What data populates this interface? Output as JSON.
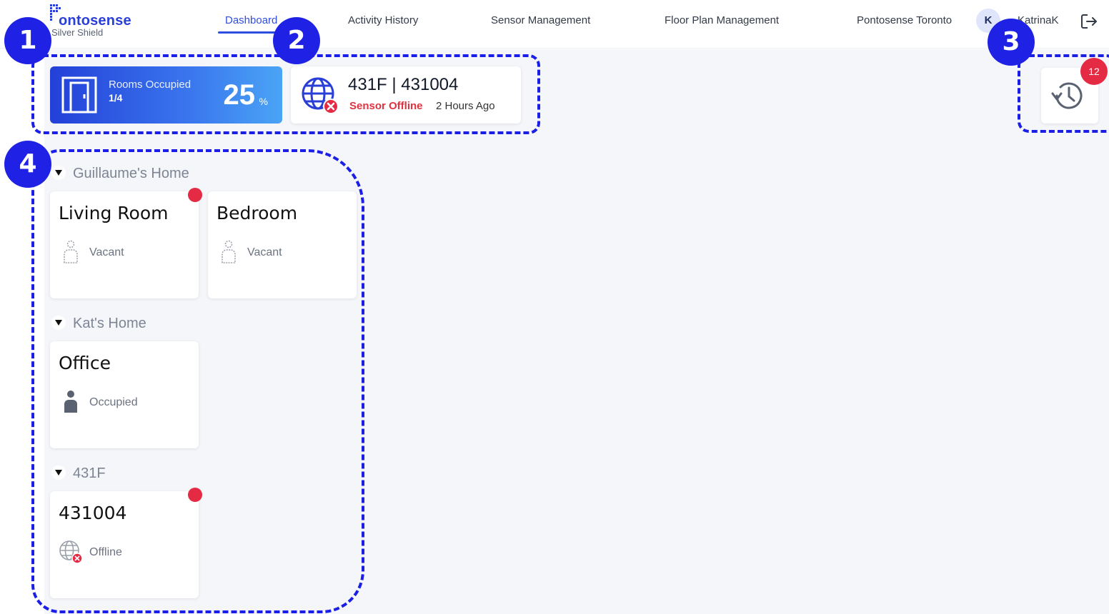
{
  "brand": {
    "name": "ontosense",
    "subtitle": "Silver Shield"
  },
  "nav": {
    "items": [
      {
        "label": "Dashboard",
        "active": true
      },
      {
        "label": "Activity History"
      },
      {
        "label": "Sensor Management"
      },
      {
        "label": "Floor Plan Management"
      },
      {
        "label": "Pontosense Toronto"
      }
    ],
    "user": {
      "initial": "K",
      "name": "KatrinaK"
    }
  },
  "stats": {
    "rooms_occupied": {
      "label": "Rooms Occupied",
      "count": "1/4",
      "percent": "25",
      "unit": "%"
    },
    "sensor": {
      "title": "431F | 431004",
      "status": "Sensor Offline",
      "time": "2 Hours Ago"
    }
  },
  "history": {
    "badge_count": "12",
    "icon": "history-clock-icon"
  },
  "groups": [
    {
      "name": "Guillaume's Home",
      "rooms": [
        {
          "name": "Living Room",
          "state": "Vacant",
          "alert": true
        },
        {
          "name": "Bedroom",
          "state": "Vacant",
          "alert": false
        }
      ]
    },
    {
      "name": "Kat's Home",
      "rooms": [
        {
          "name": "Office",
          "state": "Occupied",
          "alert": false
        }
      ]
    },
    {
      "name": "431F",
      "rooms": [
        {
          "name": "431004",
          "state": "Offline",
          "alert": true
        }
      ]
    }
  ],
  "annotations": [
    "1",
    "2",
    "3",
    "4"
  ],
  "colors": {
    "accent": "#2f4ee0",
    "alert": "#e52b44",
    "annotation": "#1f22e4"
  }
}
